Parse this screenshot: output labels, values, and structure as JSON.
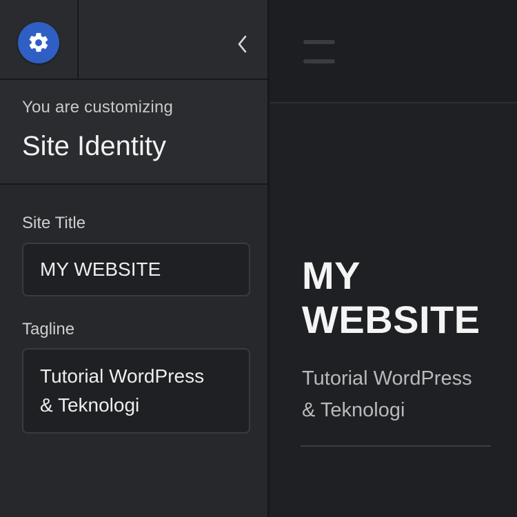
{
  "panel": {
    "customizing_label": "You are customizing",
    "section_title": "Site Identity",
    "fields": [
      {
        "label": "Site Title",
        "value": "MY WEBSITE"
      },
      {
        "label": "Tagline",
        "value": "Tutorial WordPress\n& Teknologi"
      }
    ],
    "icons": {
      "settings": "gear-icon",
      "back": "chevron-left-icon"
    },
    "accent": "#2f5fc4"
  },
  "preview": {
    "site_title": "MY\nWEBSITE",
    "tagline": "Tutorial WordPress\n& Teknologi",
    "icons": {
      "menu": "hamburger-icon"
    }
  }
}
